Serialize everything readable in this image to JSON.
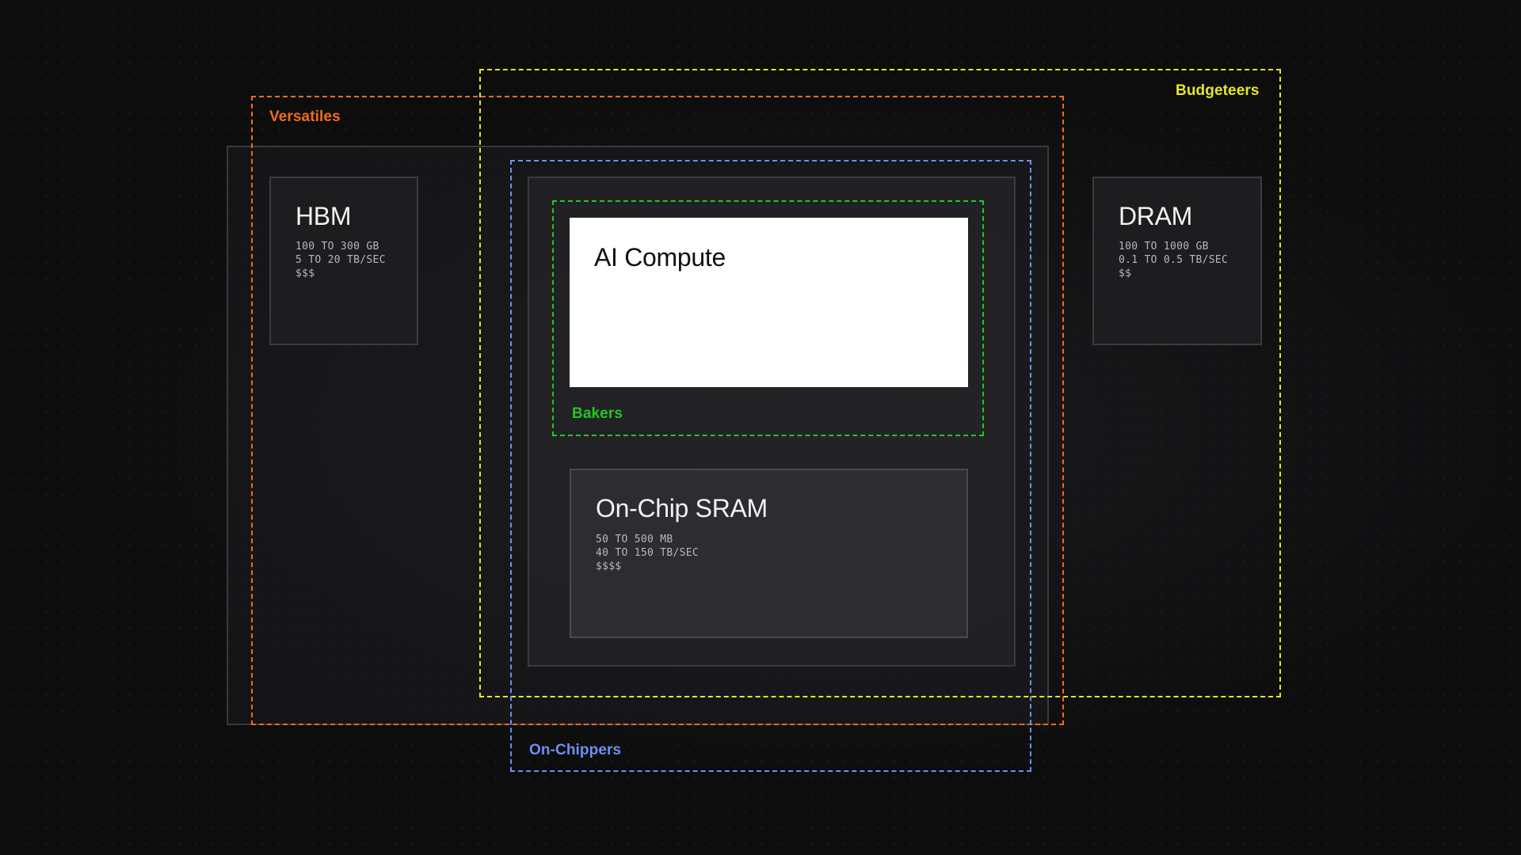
{
  "colors": {
    "budgeteers": "#e6e62a",
    "versatiles": "#f26a1b",
    "on_chippers": "#6f8ff0",
    "bakers": "#22c722"
  },
  "regions": {
    "budgeteers": "Budgeteers",
    "versatiles": "Versatiles",
    "on_chippers": "On-Chippers",
    "bakers": "Bakers"
  },
  "components": {
    "hbm": {
      "title": "HBM",
      "capacity": "100 TO 300 GB",
      "bandwidth": "5 TO 20 TB/SEC",
      "cost": "$$$"
    },
    "dram": {
      "title": "DRAM",
      "capacity": "100 TO 1000 GB",
      "bandwidth": "0.1 TO 0.5 TB/SEC",
      "cost": "$$"
    },
    "sram": {
      "title": "On-Chip SRAM",
      "capacity": "50 TO 500 MB",
      "bandwidth": "40 TO 150 TB/SEC",
      "cost": "$$$$"
    },
    "compute": {
      "title": "AI Compute"
    }
  }
}
